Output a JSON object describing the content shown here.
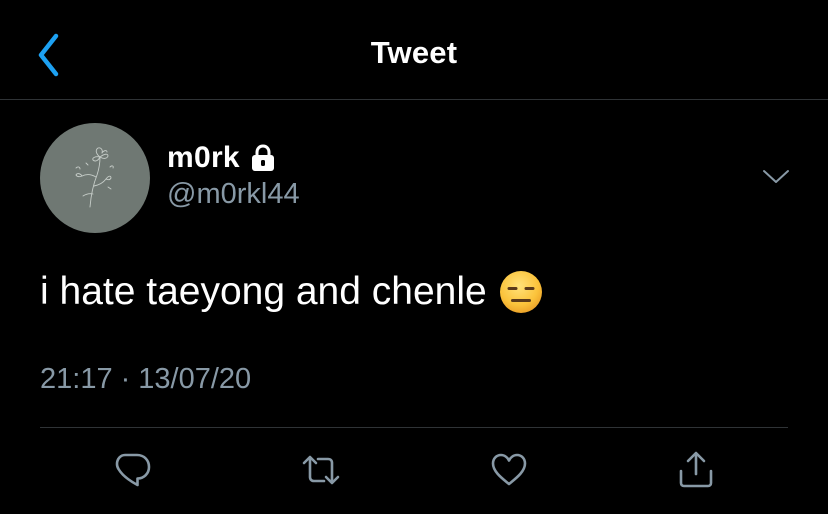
{
  "header": {
    "title": "Tweet",
    "back_icon": "chevron-left-icon"
  },
  "tweet": {
    "author_name": "m0rk",
    "author_handle": "@m0rkl44",
    "protected_icon": "lock-icon",
    "text": "i hate taeyong and chenle",
    "emoji": "😑",
    "time": "21:17",
    "separator": "·",
    "date": "13/07/20"
  },
  "actions": [
    {
      "name": "reply",
      "icon": "reply-icon"
    },
    {
      "name": "retweet",
      "icon": "retweet-icon"
    },
    {
      "name": "like",
      "icon": "heart-icon"
    },
    {
      "name": "share",
      "icon": "share-icon"
    }
  ],
  "colors": {
    "background": "#000000",
    "accent": "#1da1f2",
    "secondary_text": "#8899a6",
    "divider": "#2f3336"
  }
}
